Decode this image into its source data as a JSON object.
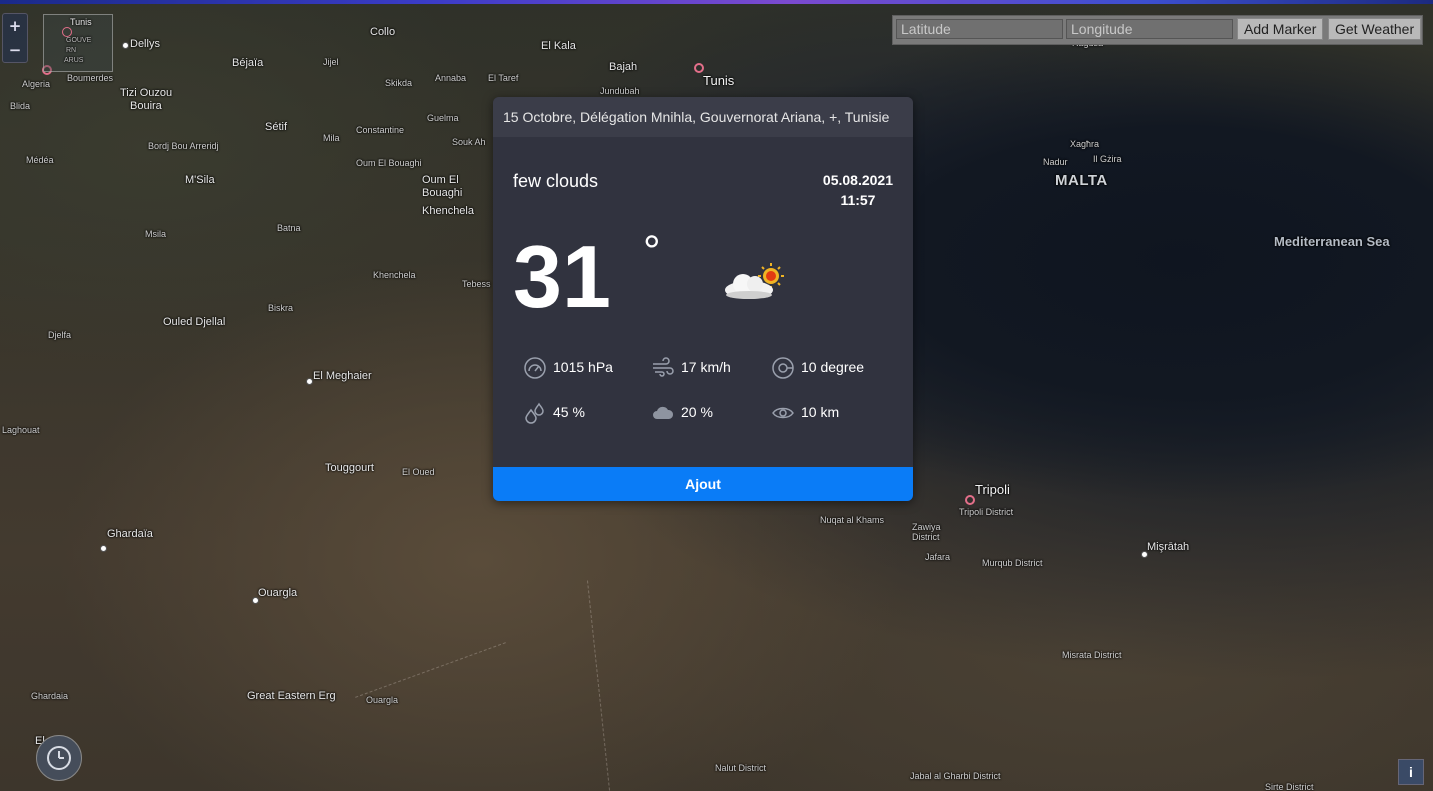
{
  "map": {
    "places": [
      {
        "name": "Tunis",
        "kind": "city"
      },
      {
        "name": "Dellys",
        "kind": "label"
      },
      {
        "name": "Collo",
        "kind": "label"
      },
      {
        "name": "El Kala",
        "kind": "label"
      },
      {
        "name": "Béjaïa",
        "kind": "label"
      },
      {
        "name": "Jijel",
        "kind": "label"
      },
      {
        "name": "Bajah",
        "kind": "label"
      },
      {
        "name": "Tizi Ouzou",
        "kind": "label"
      },
      {
        "name": "Boumerdes",
        "kind": "label"
      },
      {
        "name": "Algeria",
        "kind": "label"
      },
      {
        "name": "Bouira",
        "kind": "label"
      },
      {
        "name": "Skikda",
        "kind": "label"
      },
      {
        "name": "Annaba",
        "kind": "label"
      },
      {
        "name": "El Taref",
        "kind": "label"
      },
      {
        "name": "Jundubah",
        "kind": "label"
      },
      {
        "name": "Blida",
        "kind": "label"
      },
      {
        "name": "Sétif",
        "kind": "label"
      },
      {
        "name": "Mila",
        "kind": "label"
      },
      {
        "name": "Constantine",
        "kind": "label"
      },
      {
        "name": "Guelma",
        "kind": "label"
      },
      {
        "name": "Souk Ah",
        "kind": "label"
      },
      {
        "name": "Bordj Bou Arreridj",
        "kind": "label"
      },
      {
        "name": "Médéa",
        "kind": "label"
      },
      {
        "name": "Oum El Bouaghi",
        "kind": "label"
      },
      {
        "name": "M'Sila",
        "kind": "label"
      },
      {
        "name": "Oum El",
        "kind": "label"
      },
      {
        "name": "Bouaghi",
        "kind": "label"
      },
      {
        "name": "Khenchela",
        "kind": "label"
      },
      {
        "name": "Batna",
        "kind": "label"
      },
      {
        "name": "Msila",
        "kind": "label"
      },
      {
        "name": "Khenchela",
        "kind": "label"
      },
      {
        "name": "Biskra",
        "kind": "label"
      },
      {
        "name": "Tebess",
        "kind": "label"
      },
      {
        "name": "Ouled Djellal",
        "kind": "label"
      },
      {
        "name": "Djelfa",
        "kind": "label"
      },
      {
        "name": "El Meghaier",
        "kind": "label"
      },
      {
        "name": "Laghouat",
        "kind": "label"
      },
      {
        "name": "Touggourt",
        "kind": "label"
      },
      {
        "name": "El Oued",
        "kind": "label"
      },
      {
        "name": "Ghardaïa",
        "kind": "label"
      },
      {
        "name": "Ouargla",
        "kind": "label"
      },
      {
        "name": "Ghardaia",
        "kind": "label"
      },
      {
        "name": "Great Eastern Erg",
        "kind": "label"
      },
      {
        "name": "Ouargla",
        "kind": "label"
      },
      {
        "name": "Ragusa",
        "kind": "label"
      },
      {
        "name": "Xagħra",
        "kind": "label"
      },
      {
        "name": "Nadur",
        "kind": "label"
      },
      {
        "name": "Il Gżira",
        "kind": "label"
      },
      {
        "name": "MALTA",
        "kind": "country"
      },
      {
        "name": "Mediterranean Sea",
        "kind": "sea"
      },
      {
        "name": "Tripoli",
        "kind": "city"
      },
      {
        "name": "Tripoli District",
        "kind": "label"
      },
      {
        "name": "Nuqat al Khams",
        "kind": "label"
      },
      {
        "name": "Zawiya",
        "kind": "label"
      },
      {
        "name": "District",
        "kind": "label"
      },
      {
        "name": "Jafara",
        "kind": "label"
      },
      {
        "name": "Murqub District",
        "kind": "label"
      },
      {
        "name": "Mişrātah",
        "kind": "label"
      },
      {
        "name": "Misrata District",
        "kind": "label"
      },
      {
        "name": "Nalut District",
        "kind": "label"
      },
      {
        "name": "Jabal al Gharbi District",
        "kind": "label"
      },
      {
        "name": "Sirte District",
        "kind": "label"
      },
      {
        "name": "El",
        "kind": "label"
      }
    ],
    "minimap_labels": [
      "Tunis",
      "GOUVE",
      "RN",
      "ARUS"
    ]
  },
  "zoom": {
    "in_label": "+",
    "out_label": "−"
  },
  "controls": {
    "latitude_placeholder": "Latitude",
    "longitude_placeholder": "Longitude",
    "add_marker_label": "Add Marker",
    "get_weather_label": "Get Weather"
  },
  "weather": {
    "location": "15 Octobre, Délégation Mnihla, Gouvernorat Ariana, +, Tunisie",
    "description": "few clouds",
    "date": "05.08.2021",
    "time": "11:57",
    "temperature": "31",
    "degree_symbol": "°",
    "icon": "few-clouds-day-icon",
    "stats": {
      "pressure": "1015 hPa",
      "wind_speed": "17 km/h",
      "wind_direction": "10 degree",
      "humidity": "45 %",
      "clouds": "20 %",
      "visibility": "10 km"
    },
    "button_label": "Ajout"
  },
  "info_label": "i"
}
